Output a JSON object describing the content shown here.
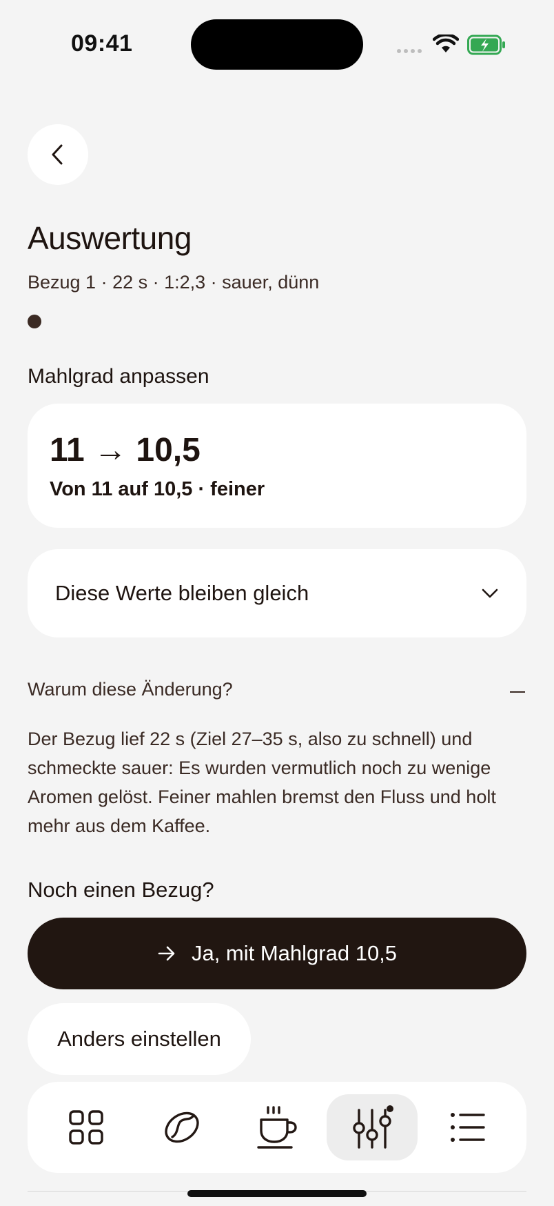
{
  "status": {
    "time": "09:41"
  },
  "header": {
    "title": "Auswertung",
    "subtitle": "Bezug 1 · 22 s · 1:2,3 · sauer, dünn"
  },
  "grind": {
    "section_label": "Mahlgrad anpassen",
    "change": "11 → 10,5",
    "description": "Von 11 auf 10,5 · feiner"
  },
  "unchanged": {
    "label": "Diese Werte bleiben gleich"
  },
  "why": {
    "label": "Warum diese Änderung?",
    "text": "Der Bezug lief 22 s (Ziel 27–35 s, also zu schnell) und schmeckte sauer: Es wurden vermutlich noch zu wenige Aromen gelöst. Feiner mahlen bremst den Fluss und holt mehr aus dem Kaffee."
  },
  "next": {
    "label": "Noch einen Bezug?",
    "primary": "Ja, mit Mahlgrad 10,5",
    "secondary": "Anders einstellen"
  },
  "nav": {
    "items": [
      {
        "icon": "grid-icon",
        "active": false
      },
      {
        "icon": "coffee-bean-icon",
        "active": false
      },
      {
        "icon": "coffee-cup-icon",
        "active": false
      },
      {
        "icon": "sliders-icon",
        "active": true
      },
      {
        "icon": "list-icon",
        "active": false
      }
    ]
  },
  "colors": {
    "background": "#f4f4f4",
    "primary": "#211611",
    "card": "#ffffff",
    "battery": "#34a853"
  }
}
